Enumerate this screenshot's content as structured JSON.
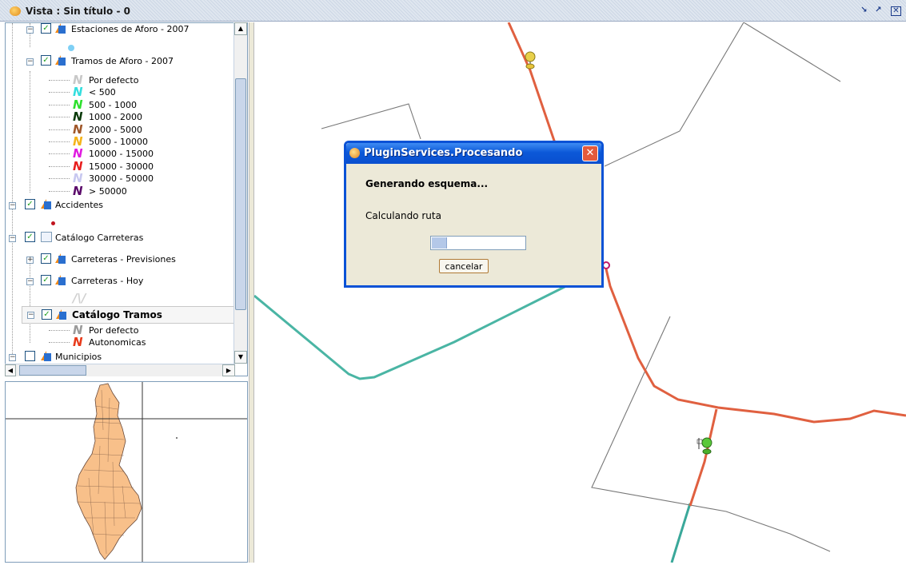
{
  "window": {
    "title": "Vista : Sin título - 0"
  },
  "toc": {
    "layers": [
      {
        "name": "Estaciones de Aforo - 2007"
      },
      {
        "name": "Tramos de Aforo - 2007"
      },
      {
        "name": "Accidentes"
      },
      {
        "name": "Catálogo Carreteras"
      },
      {
        "name": "Carreteras - Previsiones"
      },
      {
        "name": "Carreteras - Hoy"
      },
      {
        "name": "Catálogo Tramos"
      },
      {
        "name": "Municipios"
      }
    ],
    "legend_tramos": [
      {
        "label": "Por defecto",
        "color": "#c8c8c8"
      },
      {
        "label": "< 500",
        "color": "#33dede"
      },
      {
        "label": "500 - 1000",
        "color": "#2ee02e"
      },
      {
        "label": "1000 - 2000",
        "color": "#0a3a0a"
      },
      {
        "label": "2000 - 5000",
        "color": "#a0582a"
      },
      {
        "label": "5000 - 10000",
        "color": "#f5b41a"
      },
      {
        "label": "10000 - 15000",
        "color": "#e01ae0"
      },
      {
        "label": "15000 - 30000",
        "color": "#e81e1e"
      },
      {
        "label": "30000 - 50000",
        "color": "#c8c8f0"
      },
      {
        "label": "> 50000",
        "color": "#5a0a6a"
      }
    ],
    "legend_tramos_cat": [
      {
        "label": "Por defecto",
        "color": "#9a9a9a"
      },
      {
        "label": "Autonomicas",
        "color": "#e83a1a"
      }
    ]
  },
  "dialog": {
    "title": "PluginServices.Procesando",
    "heading": "Generando esquema...",
    "message": "Calculando ruta",
    "progress": 0.15,
    "cancel_label": "cancelar"
  }
}
